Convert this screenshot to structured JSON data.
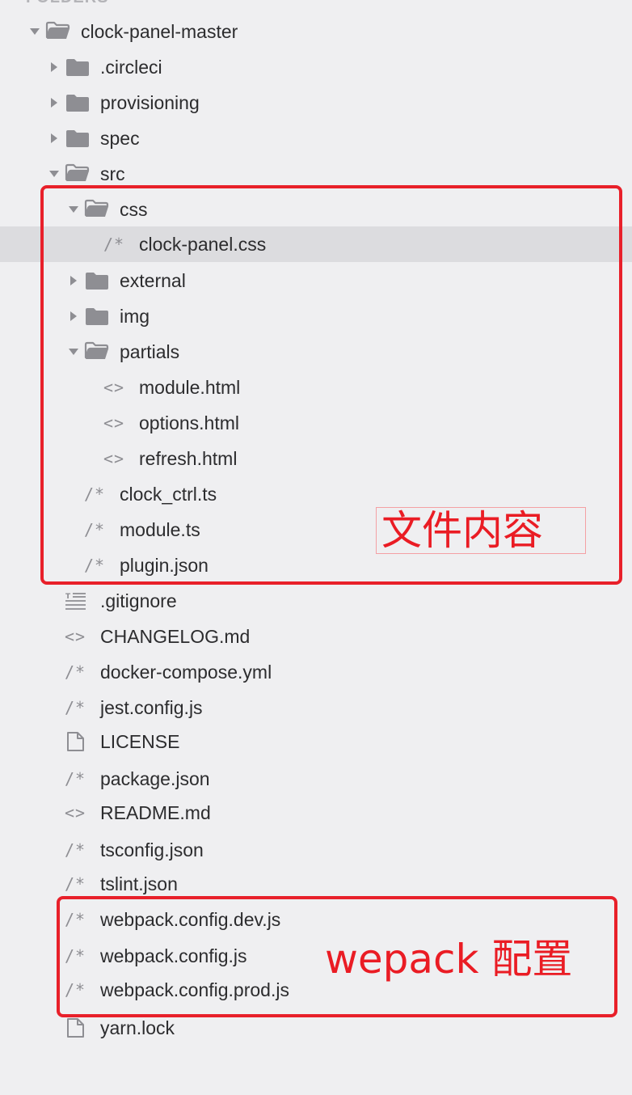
{
  "sidebar": {
    "section_header": "FOLDERS",
    "items": [
      {
        "label": "clock-panel-master",
        "kind": "folder-open",
        "arrow": "down",
        "icon_name": "folder-open-icon",
        "depth": 0
      },
      {
        "label": ".circleci",
        "kind": "folder",
        "arrow": "right",
        "icon_name": "folder-icon",
        "depth": 1
      },
      {
        "label": "provisioning",
        "kind": "folder",
        "arrow": "right",
        "icon_name": "folder-icon",
        "depth": 1
      },
      {
        "label": "spec",
        "kind": "folder",
        "arrow": "right",
        "icon_name": "folder-icon",
        "depth": 1
      },
      {
        "label": "src",
        "kind": "folder-open",
        "arrow": "down",
        "icon_name": "folder-open-icon",
        "depth": 1
      },
      {
        "label": "css",
        "kind": "folder-open",
        "arrow": "down",
        "icon_name": "folder-open-icon",
        "depth": 2
      },
      {
        "label": "clock-panel.css",
        "kind": "code",
        "arrow": "none",
        "icon_name": "comment-code-icon",
        "glyph": "/*",
        "depth": 3,
        "selected": true
      },
      {
        "label": "external",
        "kind": "folder",
        "arrow": "right",
        "icon_name": "folder-icon",
        "depth": 2
      },
      {
        "label": "img",
        "kind": "folder",
        "arrow": "right",
        "icon_name": "folder-icon",
        "depth": 2
      },
      {
        "label": "partials",
        "kind": "folder-open",
        "arrow": "down",
        "icon_name": "folder-open-icon",
        "depth": 2
      },
      {
        "label": "module.html",
        "kind": "markup",
        "arrow": "none",
        "icon_name": "angle-brackets-icon",
        "glyph": "<>",
        "depth": 3
      },
      {
        "label": "options.html",
        "kind": "markup",
        "arrow": "none",
        "icon_name": "angle-brackets-icon",
        "glyph": "<>",
        "depth": 3
      },
      {
        "label": "refresh.html",
        "kind": "markup",
        "arrow": "none",
        "icon_name": "angle-brackets-icon",
        "glyph": "<>",
        "depth": 3
      },
      {
        "label": "clock_ctrl.ts",
        "kind": "code",
        "arrow": "none",
        "icon_name": "comment-code-icon",
        "glyph": "/*",
        "depth": 2
      },
      {
        "label": "module.ts",
        "kind": "code",
        "arrow": "none",
        "icon_name": "comment-code-icon",
        "glyph": "/*",
        "depth": 2
      },
      {
        "label": "plugin.json",
        "kind": "code",
        "arrow": "none",
        "icon_name": "comment-code-icon",
        "glyph": "/*",
        "depth": 2
      },
      {
        "label": ".gitignore",
        "kind": "lines",
        "arrow": "none",
        "icon_name": "text-lines-icon",
        "depth": 1
      },
      {
        "label": "CHANGELOG.md",
        "kind": "markup",
        "arrow": "none",
        "icon_name": "angle-brackets-icon",
        "glyph": "<>",
        "depth": 1
      },
      {
        "label": "docker-compose.yml",
        "kind": "code",
        "arrow": "none",
        "icon_name": "comment-code-icon",
        "glyph": "/*",
        "depth": 1
      },
      {
        "label": "jest.config.js",
        "kind": "code",
        "arrow": "none",
        "icon_name": "comment-code-icon",
        "glyph": "/*",
        "depth": 1
      },
      {
        "label": "LICENSE",
        "kind": "file",
        "arrow": "none",
        "icon_name": "file-icon",
        "depth": 1
      },
      {
        "label": "package.json",
        "kind": "code",
        "arrow": "none",
        "icon_name": "comment-code-icon",
        "glyph": "/*",
        "depth": 1
      },
      {
        "label": "README.md",
        "kind": "markup",
        "arrow": "none",
        "icon_name": "angle-brackets-icon",
        "glyph": "<>",
        "depth": 1
      },
      {
        "label": "tsconfig.json",
        "kind": "code",
        "arrow": "none",
        "icon_name": "comment-code-icon",
        "glyph": "/*",
        "depth": 1
      },
      {
        "label": "tslint.json",
        "kind": "code",
        "arrow": "none",
        "icon_name": "comment-code-icon",
        "glyph": "/*",
        "depth": 1
      },
      {
        "label": "webpack.config.dev.js",
        "kind": "code",
        "arrow": "none",
        "icon_name": "comment-code-icon",
        "glyph": "/*",
        "depth": 1
      },
      {
        "label": "webpack.config.js",
        "kind": "code",
        "arrow": "none",
        "icon_name": "comment-code-icon",
        "glyph": "/*",
        "depth": 1
      },
      {
        "label": "webpack.config.prod.js",
        "kind": "code",
        "arrow": "none",
        "icon_name": "comment-code-icon",
        "glyph": "/*",
        "depth": 1
      },
      {
        "label": "yarn.lock",
        "kind": "file",
        "arrow": "none",
        "icon_name": "file-icon",
        "depth": 1
      }
    ]
  },
  "annotations": {
    "src_content_label": "文件内容",
    "webpack_label": "wepack 配置"
  },
  "colors": {
    "background": "#efeff1",
    "selected_row": "#dcdcdf",
    "annotation_red": "#e8202a",
    "icon_gray": "#8e8e93",
    "text": "#2c2c2e"
  }
}
